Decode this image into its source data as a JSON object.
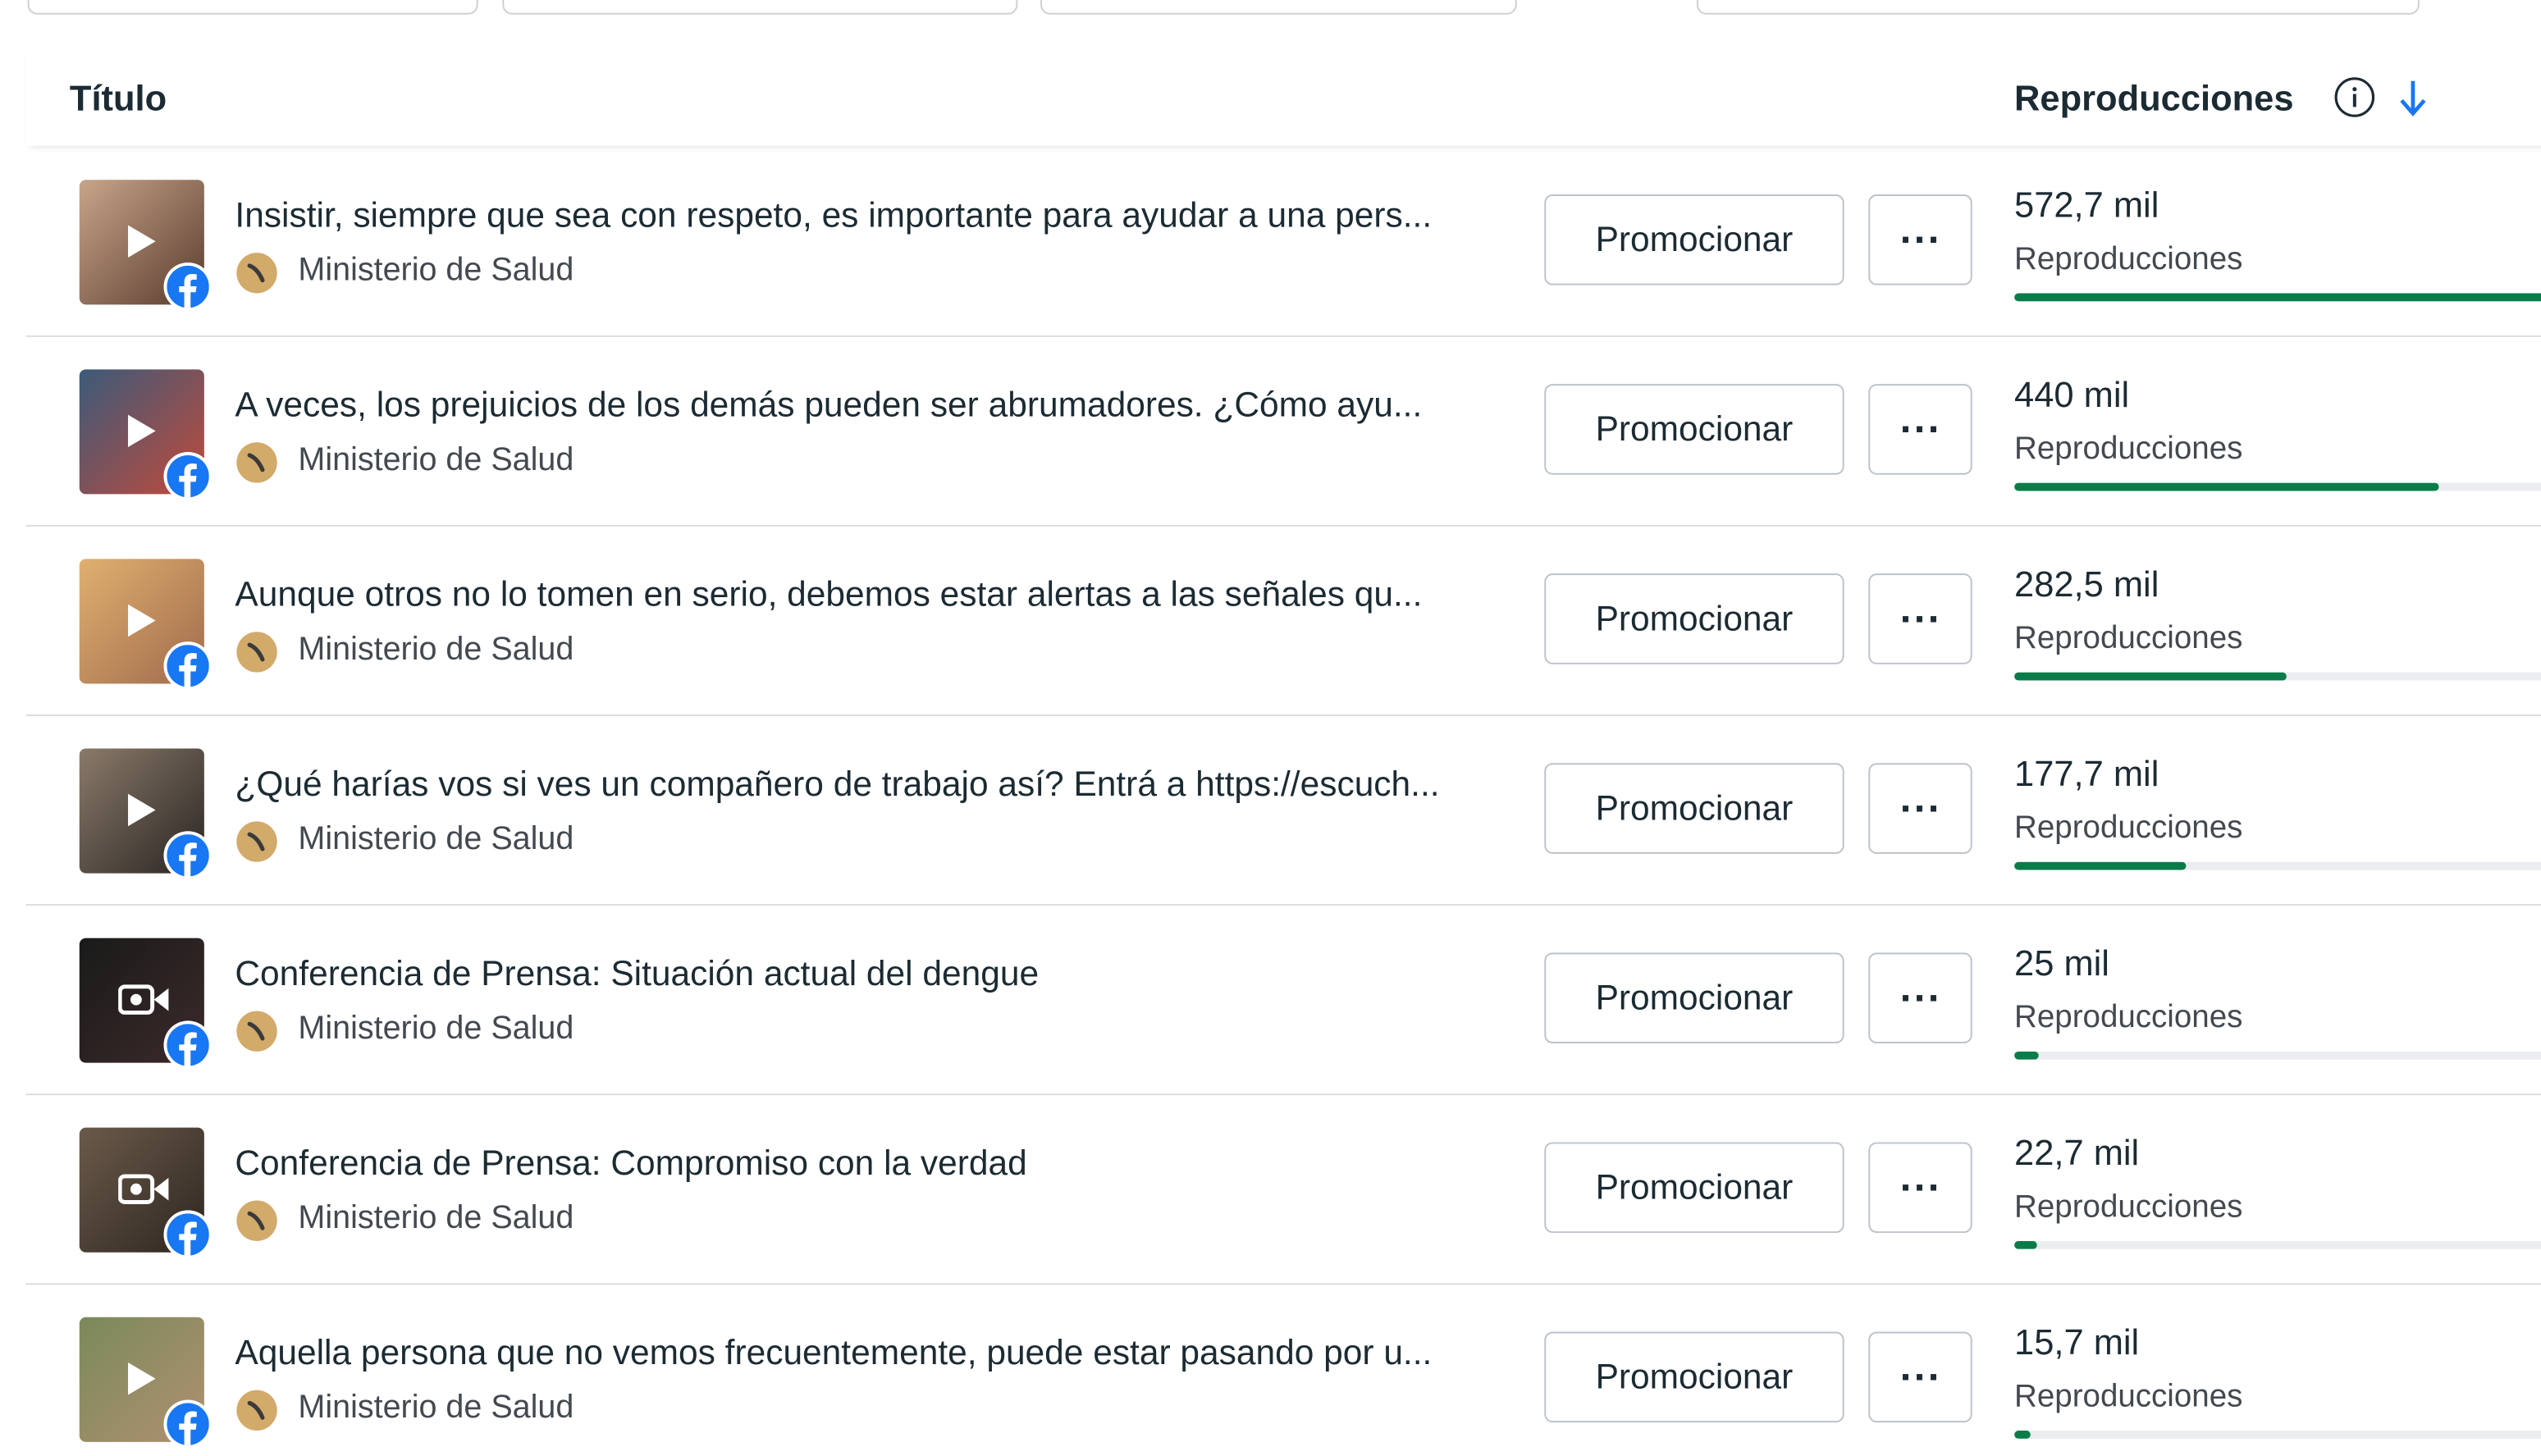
{
  "header": {
    "title_col": "Título",
    "views_col": "Reproducciones"
  },
  "colors": {
    "bar": "#0a7c4a",
    "facebook": "#1877f2",
    "avatar": "#d2aa6a"
  },
  "actions": {
    "promote_label": "Promocionar",
    "more_label": "···"
  },
  "rows": [
    {
      "title": "Insistir, siempre que sea con respeto, es importante para ayudar a una pers...",
      "page": "Ministerio de Salud",
      "views": "572,7 mil",
      "views_label": "Reproducciones",
      "thumb_icon": "play-icon",
      "thumb_colors": [
        "#c8a58a",
        "#5a3c2e"
      ],
      "views_fraction": 1.0
    },
    {
      "title": "A veces, los prejuicios de los demás pueden ser abrumadores. ¿Cómo ayu...",
      "page": "Ministerio de Salud",
      "views": "440 mil",
      "views_label": "Reproducciones",
      "thumb_icon": "play-icon",
      "thumb_colors": [
        "#3b5a7a",
        "#c24a3a"
      ],
      "views_fraction": 0.768
    },
    {
      "title": "Aunque otros no lo tomen en serio, debemos estar alertas a las señales qu...",
      "page": "Ministerio de Salud",
      "views": "282,5 mil",
      "views_label": "Reproducciones",
      "thumb_icon": "play-icon",
      "thumb_colors": [
        "#e0b070",
        "#a06a4c"
      ],
      "views_fraction": 0.493
    },
    {
      "title": "¿Qué harías vos si ves un compañero de trabajo así? Entrá a https://escuch...",
      "page": "Ministerio de Salud",
      "views": "177,7 mil",
      "views_label": "Reproducciones",
      "thumb_icon": "play-icon",
      "thumb_colors": [
        "#8a7a6a",
        "#2a2522"
      ],
      "views_fraction": 0.31
    },
    {
      "title": "Conferencia de Prensa: Situación actual del dengue",
      "page": "Ministerio de Salud",
      "views": "25 mil",
      "views_label": "Reproducciones",
      "thumb_icon": "video-camera-icon",
      "thumb_colors": [
        "#1a1a1a",
        "#3c2a2a"
      ],
      "views_fraction": 0.044
    },
    {
      "title": "Conferencia de Prensa: Compromiso con la verdad",
      "page": "Ministerio de Salud",
      "views": "22,7 mil",
      "views_label": "Reproducciones",
      "thumb_icon": "video-camera-icon",
      "thumb_colors": [
        "#6a5a4a",
        "#2e2620"
      ],
      "views_fraction": 0.04
    },
    {
      "title": "Aquella persona que no vemos frecuentemente, puede estar pasando por u...",
      "page": "Ministerio de Salud",
      "views": "15,7 mil",
      "views_label": "Reproducciones",
      "thumb_icon": "play-icon",
      "thumb_colors": [
        "#7a8a5a",
        "#b09070"
      ],
      "views_fraction": 0.027
    }
  ]
}
